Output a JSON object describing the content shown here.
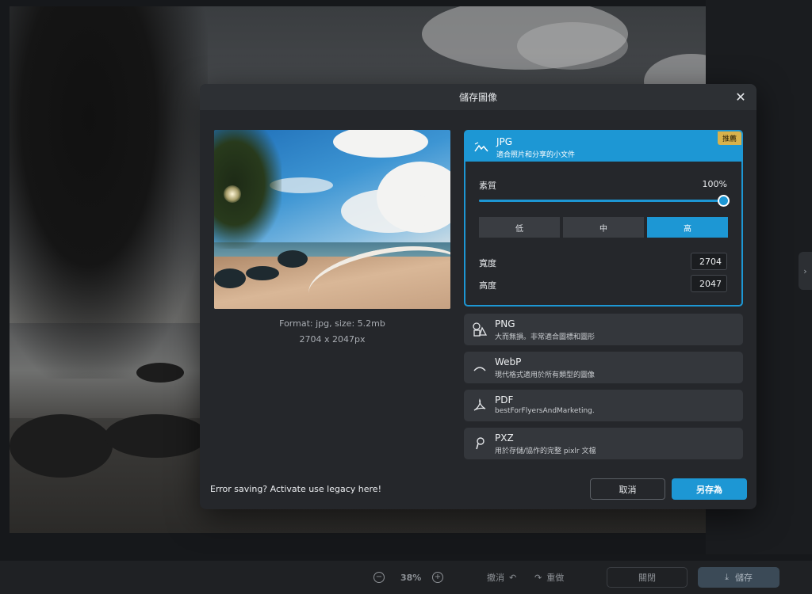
{
  "dialog": {
    "title": "儲存圖像",
    "close_icon": "close-icon",
    "preview": {
      "format_line": "Format: jpg, size: 5.2mb",
      "dimension_line": "2704 x 2047px"
    },
    "formats": [
      {
        "name": "JPG",
        "desc": "適合照片和分享的小文件",
        "icon": "mountain-icon",
        "badge": "推薦",
        "selected": true,
        "quality_label": "素質",
        "quality_value": "100%",
        "quality": 1.0,
        "levels": [
          "低",
          "中",
          "高"
        ],
        "active_level": "高",
        "width_label": "寬度",
        "width_value": "2704",
        "height_label": "高度",
        "height_value": "2047"
      },
      {
        "name": "PNG",
        "desc": "大而無損。非常適合圖標和圖形",
        "icon": "shapes-icon"
      },
      {
        "name": "WebP",
        "desc": "現代格式適用於所有類型的圖像",
        "icon": "webp-icon"
      },
      {
        "name": "PDF",
        "desc": "bestForFlyersAndMarketing.",
        "icon": "pdf-icon"
      },
      {
        "name": "PXZ",
        "desc": "用於存儲/協作的完整 pixlr 文檔",
        "icon": "pxz-icon"
      }
    ],
    "legacy_text": "Error saving? Activate use legacy here!",
    "cancel_label": "取消",
    "save_as_label": "另存為"
  },
  "bottom_bar": {
    "zoom": "38%",
    "undo_label": "撤消",
    "redo_label": "重做",
    "close_label": "關閉",
    "save_label": "儲存"
  },
  "colors": {
    "accent": "#1d97d4",
    "badge": "#d8b24c",
    "dialog_bg": "#25272b"
  }
}
